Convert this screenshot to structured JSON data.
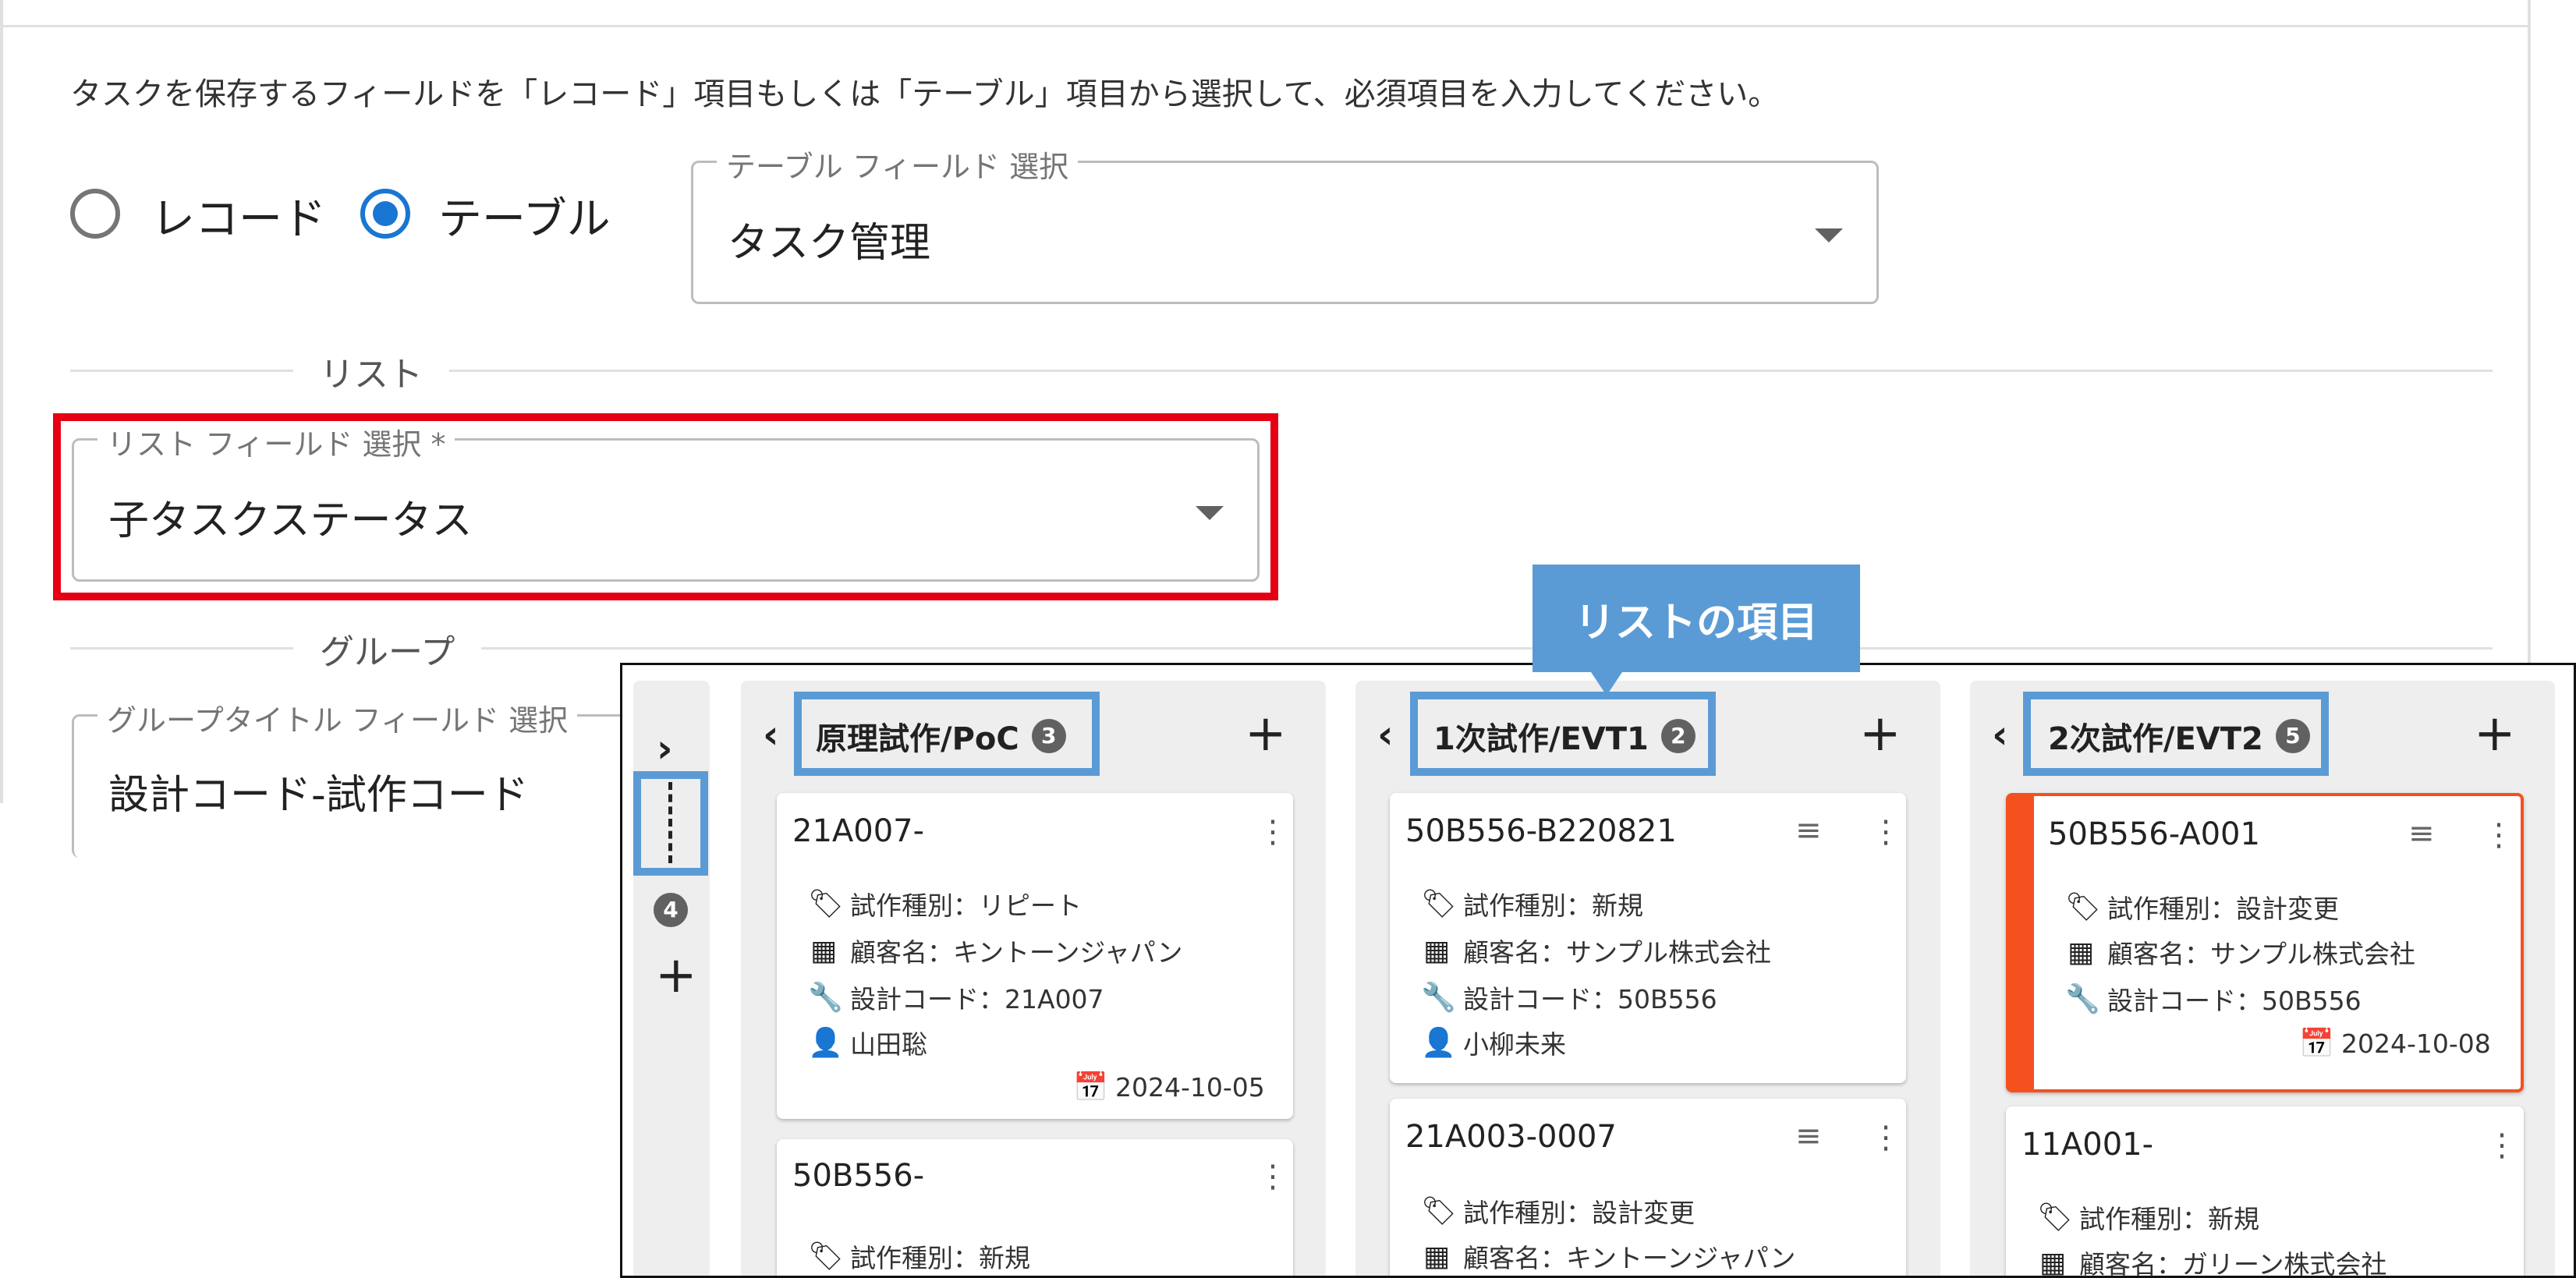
{
  "settings": {
    "instruction": "タスクを保存するフィールドを「レコード」項目もしくは「テーブル」項目から選択して、必須項目を入力してください。",
    "radio_record": "レコード",
    "radio_table": "テーブル",
    "table_field": {
      "legend": "テーブル フィールド 選択",
      "value": "タスク管理"
    },
    "list_section": "リスト",
    "list_field": {
      "legend": "リスト フィールド 選択 *",
      "value": "子タスクステータス"
    },
    "group_section": "グループ",
    "group_field": {
      "legend": "グループタイトル フィールド 選択",
      "value": "設計コード-試作コード"
    }
  },
  "callout": "リストの項目",
  "sidebar": {
    "count": "4"
  },
  "columns": [
    {
      "title": "原理試作/PoC",
      "count": "3",
      "cards": [
        {
          "title": "21A007-",
          "type": "試作種別：リピート",
          "customer": "顧客名：キントーンジャパン",
          "design": "設計コード：21A007",
          "person": "山田聡",
          "date": "2024-10-05"
        },
        {
          "title": "50B556-",
          "type": "試作種別：新規"
        }
      ]
    },
    {
      "title": "1次試作/EVT1",
      "count": "2",
      "cards": [
        {
          "title": "50B556-B220821",
          "type": "試作種別：新規",
          "customer": "顧客名：サンプル株式会社",
          "design": "設計コード：50B556",
          "person": "小柳未来"
        },
        {
          "title": "21A003-0007",
          "type": "試作種別：設計変更",
          "customer": "顧客名：キントーンジャパン"
        }
      ]
    },
    {
      "title": "2次試作/EVT2",
      "count": "5",
      "cards": [
        {
          "title": "50B556-A001",
          "type": "試作種別：設計変更",
          "customer": "顧客名：サンプル株式会社",
          "design": "設計コード：50B556",
          "date": "2024-10-08"
        },
        {
          "title": "11A001-",
          "type": "試作種別：新規",
          "customer": "顧客名：ガリーン株式会社"
        }
      ]
    }
  ],
  "colors": {
    "accent_blue": "#1976d2",
    "highlight_red": "#e60012",
    "annotation_blue": "#5b9bd5",
    "card_accent": "#f4511e"
  }
}
